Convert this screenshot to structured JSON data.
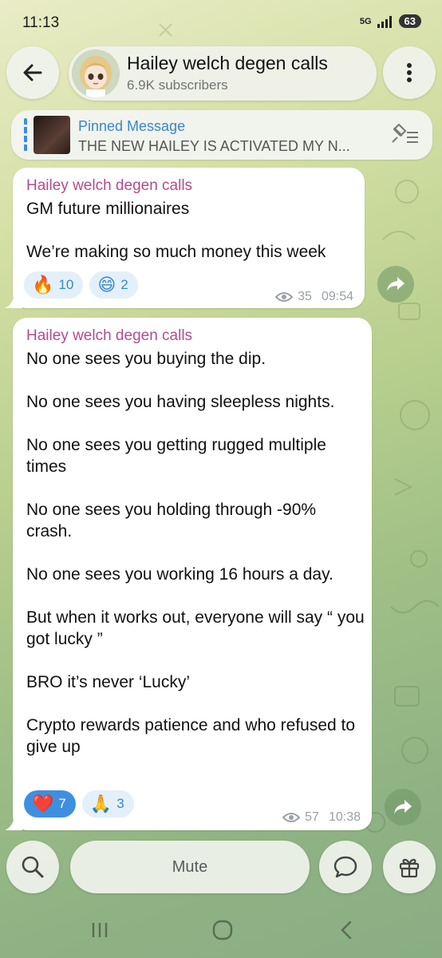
{
  "status_bar": {
    "time": "11:13",
    "network": "5G",
    "battery": "63"
  },
  "header": {
    "title": "Hailey welch degen calls",
    "subtitle": "6.9K subscribers"
  },
  "pinned": {
    "label": "Pinned Message",
    "text": "THE NEW HAILEY IS ACTIVATED   MY N..."
  },
  "messages": [
    {
      "author": "Hailey welch degen calls",
      "text": "GM future millionaires\n\nWe’re making so much money this week",
      "reactions": [
        {
          "emoji": "🔥",
          "count": "10"
        },
        {
          "emoji": "😄",
          "count": "2"
        }
      ],
      "views": "35",
      "time": "09:54"
    },
    {
      "author": "Hailey welch degen calls",
      "text": "No one sees you buying the dip.\n\nNo one sees you having sleepless nights.\n\nNo one sees you getting rugged multiple times\n\nNo one sees you holding through -90% crash.\n\nNo one sees you working 16 hours a day.\n\nBut when it works out, everyone will say “ you got lucky ”\n\nBRO it’s never  ‘Lucky’\n\nCrypto rewards patience and who refused to give up",
      "reactions": [
        {
          "emoji": "❤️",
          "count": "7"
        },
        {
          "emoji": "🙏",
          "count": "3"
        }
      ],
      "views": "57",
      "time": "10:38"
    }
  ],
  "bottom_bar": {
    "mute_label": "Mute"
  },
  "icons": {
    "back": "arrow-left-icon",
    "menu": "kebab-menu-icon",
    "unpin": "pin-list-icon",
    "forward": "forward-arrow-icon",
    "search": "search-icon",
    "comment": "chat-bubble-icon",
    "gift": "gift-icon",
    "views": "eye-icon"
  },
  "colors": {
    "author": "#b24c8e",
    "link": "#3a86c9",
    "reaction_active": "#3f8fe0"
  }
}
